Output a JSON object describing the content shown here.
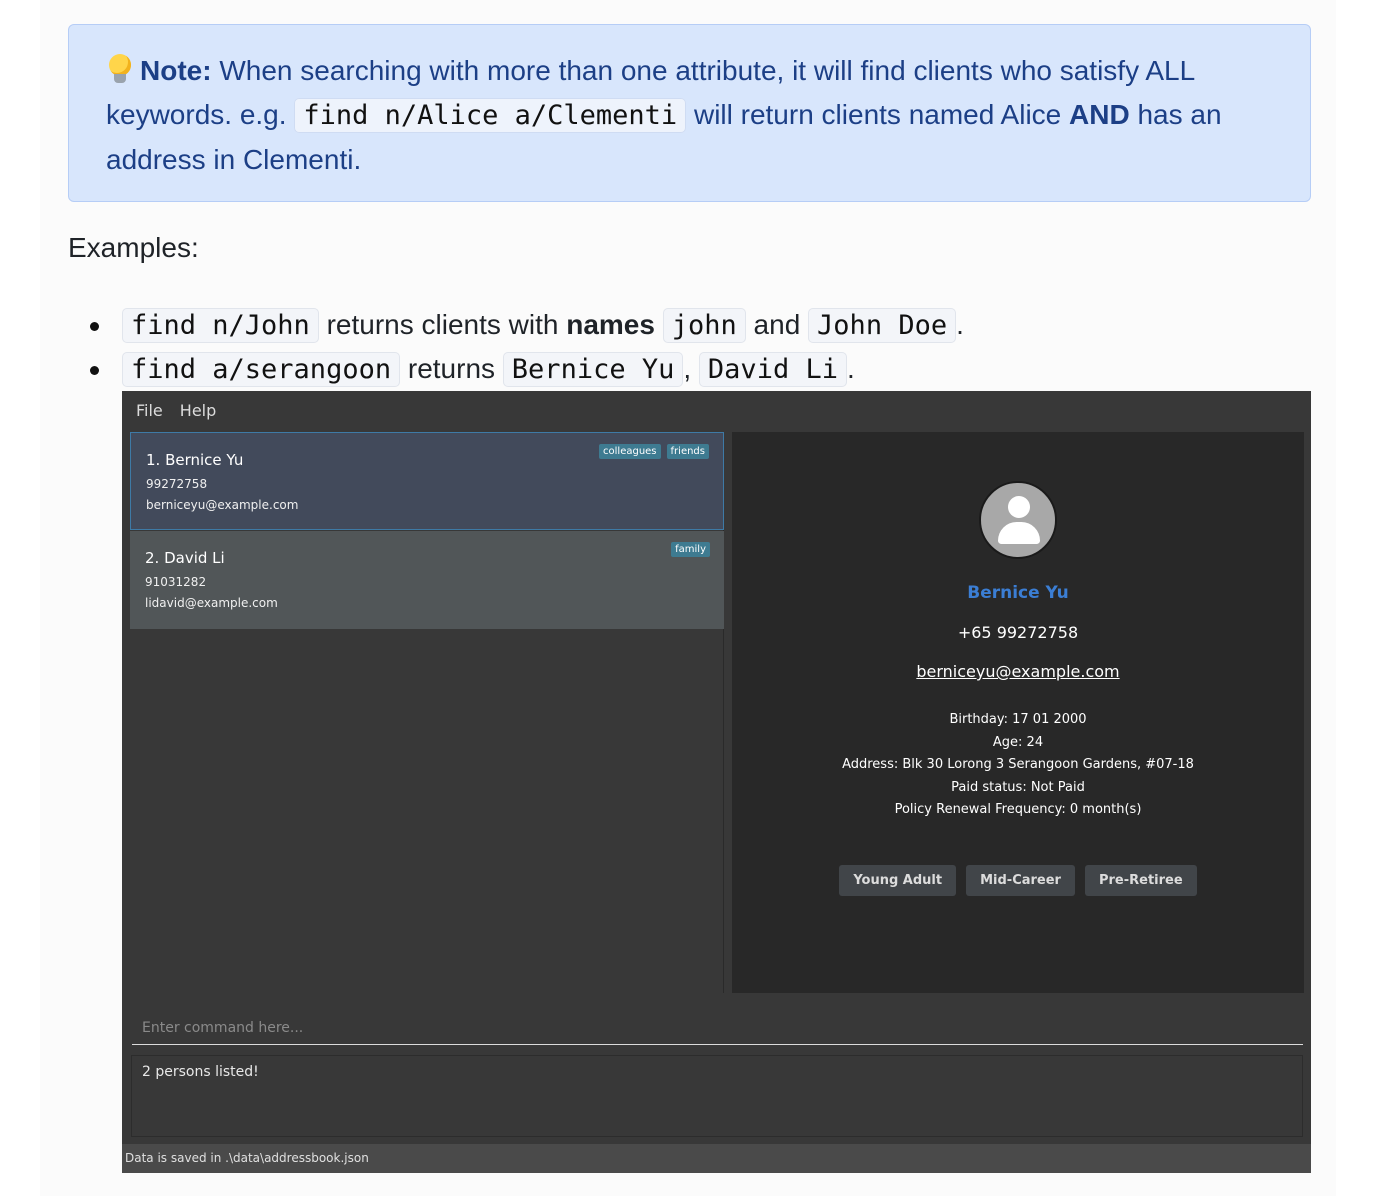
{
  "note": {
    "label": "Note:",
    "text1": " When searching with more than one attribute, it will find clients who satisfy ALL keywords. e.g. ",
    "code": "find n/Alice a/Clementi",
    "text2": " will return clients named Alice ",
    "bold": "AND",
    "text3": " has an address in Clementi.",
    "icon": "lightbulb-icon"
  },
  "examples": {
    "heading": "Examples:",
    "b1": {
      "code1": "find n/John",
      "t1": " returns clients with ",
      "bold": "names",
      "code2": "john",
      "t2": " and ",
      "code3": "John Doe",
      "t3": "."
    },
    "b2": {
      "code1": "find a/serangoon",
      "t1": " returns ",
      "code2": "Bernice Yu",
      "t2": ", ",
      "code3": "David Li",
      "t3": "."
    }
  },
  "app": {
    "menu": [
      "File",
      "Help"
    ],
    "persons": [
      {
        "name": "1.  Bernice Yu",
        "phone": "99272758",
        "email": "berniceyu@example.com",
        "tags": [
          "colleagues",
          "friends"
        ]
      },
      {
        "name": "2.  David Li",
        "phone": "91031282",
        "email": "lidavid@example.com",
        "tags": [
          "family"
        ]
      }
    ],
    "detail": {
      "name": "Bernice Yu",
      "phone": "+65 99272758",
      "email": "berniceyu@example.com",
      "birthday": "Birthday: 17 01 2000",
      "age": "Age: 24",
      "address": "Address: Blk 30 Lorong 3 Serangoon Gardens, #07-18",
      "paid": "Paid status: Not Paid",
      "renewal": "Policy Renewal Frequency: 0 month(s)",
      "buttons": [
        "Young Adult",
        "Mid-Career",
        "Pre-Retiree"
      ]
    },
    "command_placeholder": "Enter command here...",
    "result": "2 persons listed!",
    "status": "Data is saved in .\\data\\addressbook.json"
  },
  "colors": {
    "note_bg": "#d8e6fc",
    "note_text": "#1c3f86",
    "accent_name": "#3b7ed4",
    "tag": "#3e7b91"
  }
}
